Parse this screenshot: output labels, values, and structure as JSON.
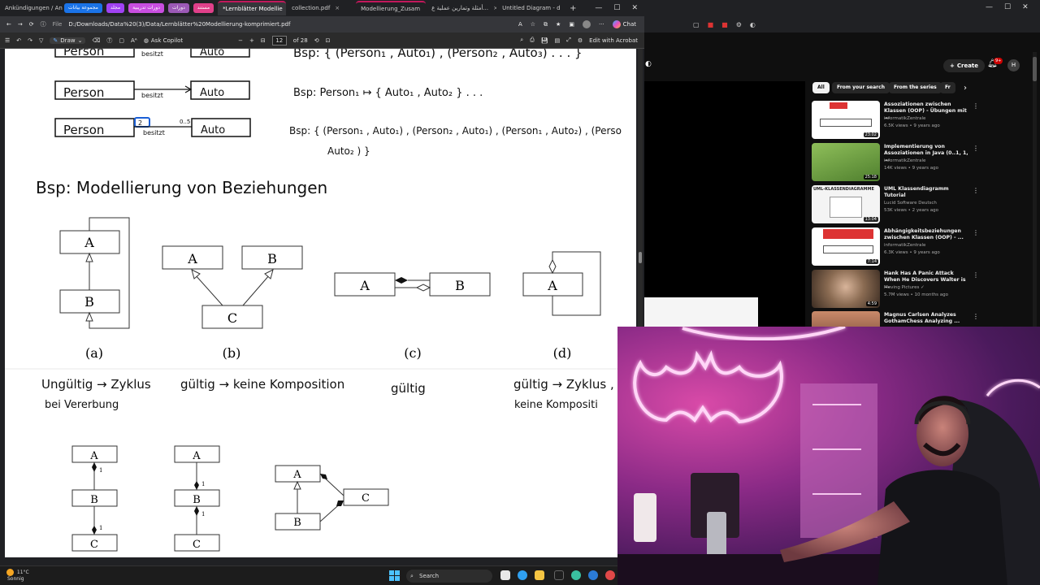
{
  "browser": {
    "tabs": [
      {
        "label": "Ankündigungen / An",
        "active": false
      },
      {
        "label": "*Lernblätter Modellie",
        "active": true
      },
      {
        "label": "collection.pdf",
        "active": false
      },
      {
        "label": "Modellierung_Zusam",
        "active": false
      },
      {
        "label": "أمثلة وتمارين عملية ع...",
        "active": false
      },
      {
        "label": "Untitled Diagram - d",
        "active": false
      }
    ],
    "pills": [
      {
        "label": "مجموعة بيانات",
        "color": "#1a73e8"
      },
      {
        "label": "مجلد",
        "color": "#a142f4"
      },
      {
        "label": "دورات تدريبية",
        "color": "#c84ee0"
      },
      {
        "label": "دورات",
        "color": "#9b59b6"
      },
      {
        "label": "مستند",
        "color": "#e0408a"
      }
    ],
    "address": {
      "file_label": "File",
      "url": "D:/Downloads/Data%20(3)/Data/Lernblätter%20Modellierung-komprimiert.pdf"
    },
    "chat_label": "Chat"
  },
  "pdf_toolbar": {
    "draw_label": "Draw",
    "copilot_label": "Ask Copilot",
    "zoom_minus": "−",
    "zoom_plus": "+",
    "page_current": "12",
    "page_total": "of 28",
    "acrobat_label": "Edit with Acrobat"
  },
  "pdf": {
    "rows": [
      {
        "left": "Person",
        "rel": "besitzt",
        "right": "Auto",
        "bsp": "Bsp:  { (Person₁ , Auto₁) , (Person₂ , Auto₃) . . . }"
      },
      {
        "left": "Person",
        "rel": "besitzt",
        "right": "Auto",
        "bsp": "Bsp:   Person₁ ↦ { Auto₁ , Auto₂ } . . ."
      },
      {
        "left": "Person",
        "rel": "besitzt",
        "right": "Auto",
        "mult_left": "2",
        "mult_right": "0..5",
        "bsp": "Bsp: { (Person₁ , Auto₁) , (Person₂ , Auto₁) , (Person₁ , Auto₂) , (Perso",
        "bsp2": "Auto₂ ) }"
      }
    ],
    "heading": "Bsp: Modellierung von Beziehungen",
    "figure_captions": [
      "(a)",
      "(b)",
      "(c)",
      "(d)"
    ],
    "box_labels": {
      "a": "A",
      "b": "B",
      "c": "C"
    },
    "verdicts": [
      {
        "line1": "Ungültig → Zyklus",
        "line2": "bei Vererbung"
      },
      {
        "line1": "gültig → keine Komposition",
        "line2": ""
      },
      {
        "line1": "gültig",
        "line2": ""
      },
      {
        "line1": "gültig → Zyklus , o",
        "line2": "keine Kompositi"
      }
    ],
    "multiplicity": "1"
  },
  "youtube": {
    "create_label": "Create",
    "notif_count": "9+",
    "avatar_letter": "H",
    "chips": [
      "All",
      "From your search",
      "From the series",
      "Fr"
    ],
    "videos": [
      {
        "title": "Assoziationen zwischen Klassen (OOP) - Übungen mit ...",
        "channel": "informatikZentrale",
        "meta": "6.5K views • 9 years ago",
        "duration": "23:02",
        "thumb_color": "#ffffff"
      },
      {
        "title": "Implementierung von Assoziationen in Java (0..1, 1, ...",
        "channel": "informatikZentrale",
        "meta": "14K views • 9 years ago",
        "duration": "25:18",
        "thumb_color": "#6fa34a"
      },
      {
        "title": "UML Klassendiagramm Tutorial",
        "channel": "Lucid Software Deutsch",
        "meta": "53K views • 2 years ago",
        "duration": "13:04",
        "thumb_color": "#f4f4f4",
        "thumb_caption": "UML-KLASSENDIAGRAMME"
      },
      {
        "title": "Abhängigkeitsbeziehungen zwischen Klassen (OOP) - ...",
        "channel": "informatikZentrale",
        "meta": "6.3K views • 9 years ago",
        "duration": "7:14",
        "thumb_color": "#ffffff"
      },
      {
        "title": "Hank Has A Panic Attack When He Discovers Walter is ...",
        "channel": "Moving Pictures ✓",
        "meta": "5.7M views • 10 months ago",
        "duration": "4:59",
        "thumb_color": "#8a6b52"
      },
      {
        "title": "Magnus Carlsen Analyzes GothamChess Analyzing ...",
        "channel": "",
        "meta": "",
        "duration": "",
        "thumb_color": "#c98a6a"
      }
    ]
  },
  "taskbar": {
    "weather_temp": "11°C",
    "weather_text": "Sonnig",
    "search_label": "Search"
  }
}
